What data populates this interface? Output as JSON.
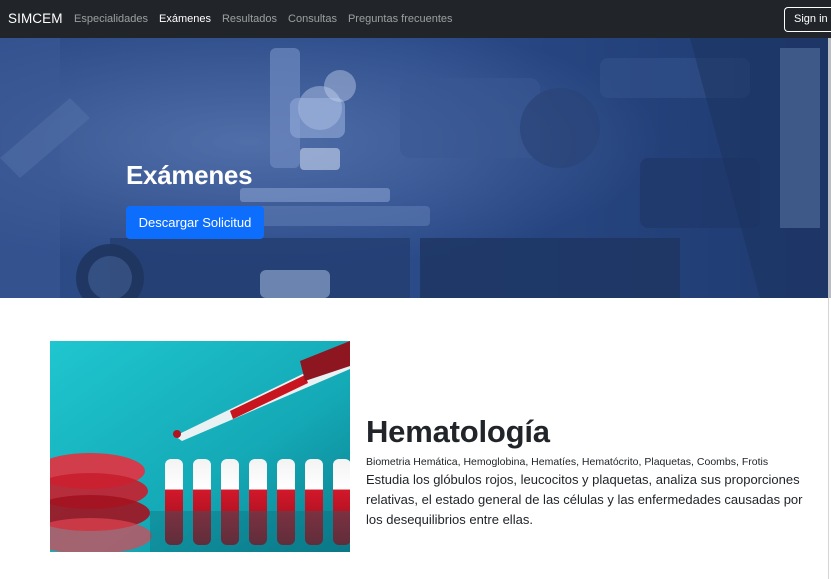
{
  "navbar": {
    "brand": "SIMCEM",
    "links": [
      {
        "label": "Especialidades",
        "active": false
      },
      {
        "label": "Exámenes",
        "active": true
      },
      {
        "label": "Resultados",
        "active": false
      },
      {
        "label": "Consultas",
        "active": false
      },
      {
        "label": "Preguntas frecuentes",
        "active": false
      }
    ],
    "signin_label": "Sign in"
  },
  "hero": {
    "title": "Exámenes",
    "button_label": "Descargar Solicitud",
    "background_image": "laboratory-microscope-image",
    "overlay_color": "#2a4d8f"
  },
  "section": {
    "image": "blood-samples-pipette-image",
    "title": "Hematología",
    "tags": "Biometria Hemática, Hemoglobina, Hematíes, Hematócrito, Plaquetas, Coombs, Frotis",
    "description": "Estudia los glóbulos rojos, leucocitos y plaquetas, analiza sus proporciones relativas, el estado general de las células y las enfermedades causadas por los desequilibrios entre ellas."
  },
  "colors": {
    "navbar_bg": "#212529",
    "primary": "#0d6efd",
    "hero_blue": "#2a4d8f"
  }
}
